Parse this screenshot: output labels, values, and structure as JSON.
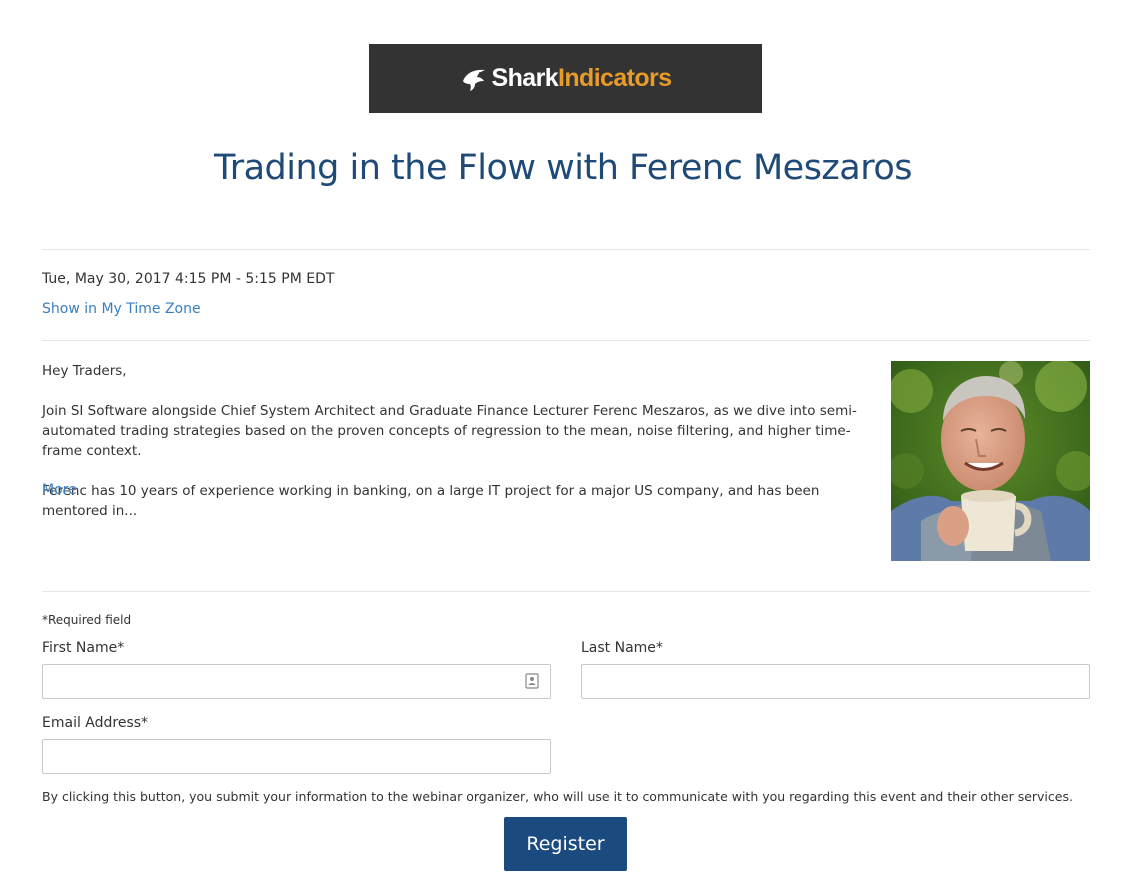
{
  "logo": {
    "part1": "Shark",
    "part2": "Indicators",
    "icon": "shark-icon",
    "colors": {
      "background": "#333333",
      "primary": "#ffffff",
      "accent": "#e89b2a"
    }
  },
  "title": "Trading in the Flow with Ferenc Meszaros",
  "schedule": {
    "datetime": "Tue, May 30, 2017 4:15 PM - 5:15 PM EDT",
    "timezone_link": "Show in My Time Zone"
  },
  "description": {
    "greeting": "Hey Traders,",
    "paragraph1": "Join SI Software alongside Chief System Architect and Graduate Finance Lecturer Ferenc Meszaros, as we dive into semi-automated trading strategies based on the proven concepts of regression to the mean, noise filtering, and higher time-frame context.",
    "paragraph2": "Ferenc has 10 years of experience working in banking, on a large IT project for a major US company, and has been mentored in...",
    "more_link": "More"
  },
  "presenter_photo": {
    "icon": "presenter-photo"
  },
  "form": {
    "required_note": "*Required field",
    "first_name_label": "First Name*",
    "first_name_value": "",
    "last_name_label": "Last Name*",
    "last_name_value": "",
    "email_label": "Email Address*",
    "email_value": "",
    "contact_icon": "contact-card-icon",
    "consent_text": "By clicking this button, you submit your information to the webinar organizer, who will use it to communicate with you regarding this event and their other services.",
    "register_label": "Register"
  },
  "colors": {
    "title": "#1f4a78",
    "link": "#3a7ebf",
    "button": "#1b4a7e",
    "text": "#333333",
    "divider": "#e6e6e6"
  }
}
